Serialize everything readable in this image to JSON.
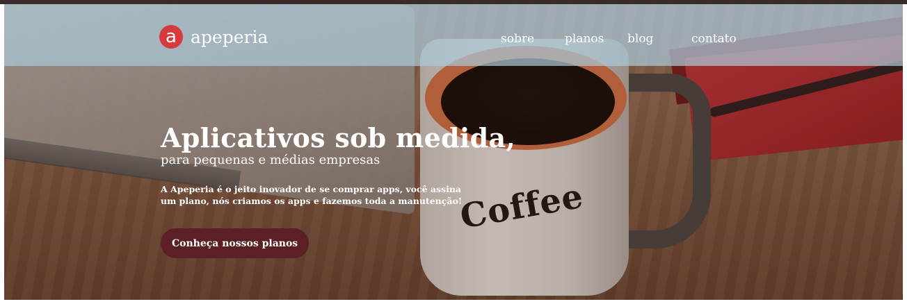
{
  "navbar": {
    "logo_mark": "a",
    "brand": "apeperia",
    "links": [
      "sobre",
      "planos",
      "blog",
      "contato"
    ]
  },
  "hero": {
    "headline": "Aplicativos sob medida,",
    "subheadline": "para pequenas e médias empresas",
    "description_line1": "A Apeperia é o jeito inovador de se comprar apps, você assina",
    "description_line2": "um plano, nós criamos os apps e fazemos toda a manutenção!",
    "cta_label": "Conheça nossos planos",
    "mug_text": "Coffee"
  },
  "colors": {
    "accent": "#d63a3f",
    "cta_bg": "#5c1f26",
    "nav_bg": "#aac8d7"
  }
}
